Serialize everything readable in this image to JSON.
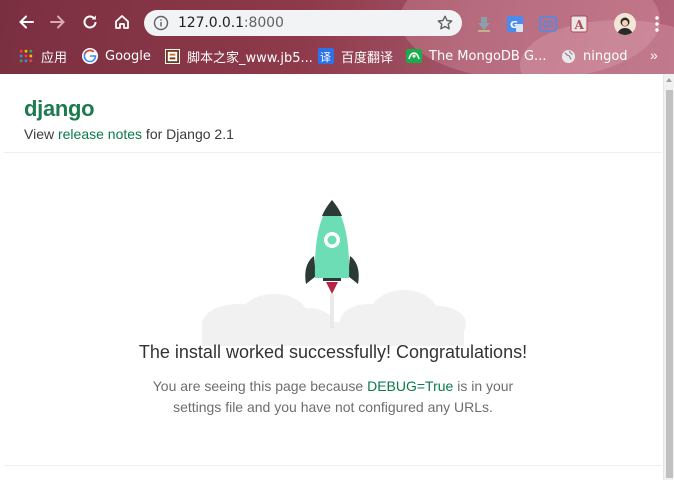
{
  "browser": {
    "url_host": "127.0.0.1",
    "url_port": ":8000",
    "bookmarks": [
      {
        "label": "应用",
        "icon": "apps-grid-icon"
      },
      {
        "label": "Google",
        "icon": "google-icon"
      },
      {
        "label": "脚本之家_www.jb5...",
        "icon": "jb51-icon"
      },
      {
        "label": "百度翻译",
        "icon": "baidu-translate-icon"
      },
      {
        "label": "The MongoDB G...",
        "icon": "mongodb-icon"
      },
      {
        "label": "ningod",
        "icon": "globe-icon"
      }
    ],
    "more_bookmarks": "»",
    "colors": {
      "chrome": "#8e3a4b",
      "omnibox": "#f1f3f4"
    }
  },
  "page": {
    "logo": "django",
    "release_prefix": "View ",
    "release_link": "release notes",
    "release_suffix": " for Django 2.1",
    "headline": "The install worked successfully! Congratulations!",
    "sub_line1_prefix": "You are seeing this page because ",
    "sub_debug": "DEBUG=True",
    "sub_line1_suffix": " is in your",
    "sub_line2": "settings file and you have not configured any URLs.",
    "colors": {
      "brand_green": "#1e7b4f",
      "link_green": "#0c7a4c",
      "rocket_body": "#6dddb6",
      "rocket_dark": "#2b3a37",
      "flame": "#b82346"
    }
  }
}
